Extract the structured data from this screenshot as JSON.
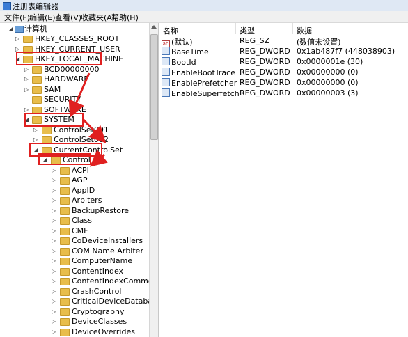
{
  "window": {
    "title": "注册表编辑器"
  },
  "menu": [
    "文件(F)",
    "编辑(E)",
    "查看(V)",
    "收藏夹(A)",
    "帮助(H)"
  ],
  "tree": {
    "root": "计算机",
    "nodes": [
      {
        "label": "HKEY_CLASSES_ROOT"
      },
      {
        "label": "HKEY_CURRENT_USER"
      },
      {
        "label": "HKEY_LOCAL_MACHINE"
      },
      {
        "label": "BCD00000000"
      },
      {
        "label": "HARDWARE"
      },
      {
        "label": "SAM"
      },
      {
        "label": "SECURITY"
      },
      {
        "label": "SOFTWARE"
      },
      {
        "label": "SYSTEM"
      },
      {
        "label": "ControlSet001"
      },
      {
        "label": "ControlSet002"
      },
      {
        "label": "CurrentControlSet"
      },
      {
        "label": "Control"
      },
      {
        "label": "ACPI"
      },
      {
        "label": "AGP"
      },
      {
        "label": "AppID"
      },
      {
        "label": "Arbiters"
      },
      {
        "label": "BackupRestore"
      },
      {
        "label": "Class"
      },
      {
        "label": "CMF"
      },
      {
        "label": "CoDeviceInstallers"
      },
      {
        "label": "COM Name Arbiter"
      },
      {
        "label": "ComputerName"
      },
      {
        "label": "ContentIndex"
      },
      {
        "label": "ContentIndexCommon"
      },
      {
        "label": "CrashControl"
      },
      {
        "label": "CriticalDeviceDatabase"
      },
      {
        "label": "Cryptography"
      },
      {
        "label": "DeviceClasses"
      },
      {
        "label": "DeviceOverrides"
      }
    ]
  },
  "values": {
    "headers": [
      "名称",
      "类型",
      "数据"
    ],
    "rows": [
      {
        "name": "(默认)",
        "type": "REG_SZ",
        "data": "(数值未设置)",
        "icon": "string-value-icon"
      },
      {
        "name": "BaseTime",
        "type": "REG_DWORD",
        "data": "0x1ab487f7 (448038903)",
        "icon": "binary-value-icon"
      },
      {
        "name": "BootId",
        "type": "REG_DWORD",
        "data": "0x0000001e (30)",
        "icon": "binary-value-icon"
      },
      {
        "name": "EnableBootTrace",
        "type": "REG_DWORD",
        "data": "0x00000000 (0)",
        "icon": "binary-value-icon"
      },
      {
        "name": "EnablePrefetcher",
        "type": "REG_DWORD",
        "data": "0x00000000 (0)",
        "icon": "binary-value-icon"
      },
      {
        "name": "EnableSuperfetch",
        "type": "REG_DWORD",
        "data": "0x00000003 (3)",
        "icon": "binary-value-icon"
      }
    ]
  },
  "colors": {
    "highlight": "#e02020",
    "folder": "#e8bd4b"
  }
}
